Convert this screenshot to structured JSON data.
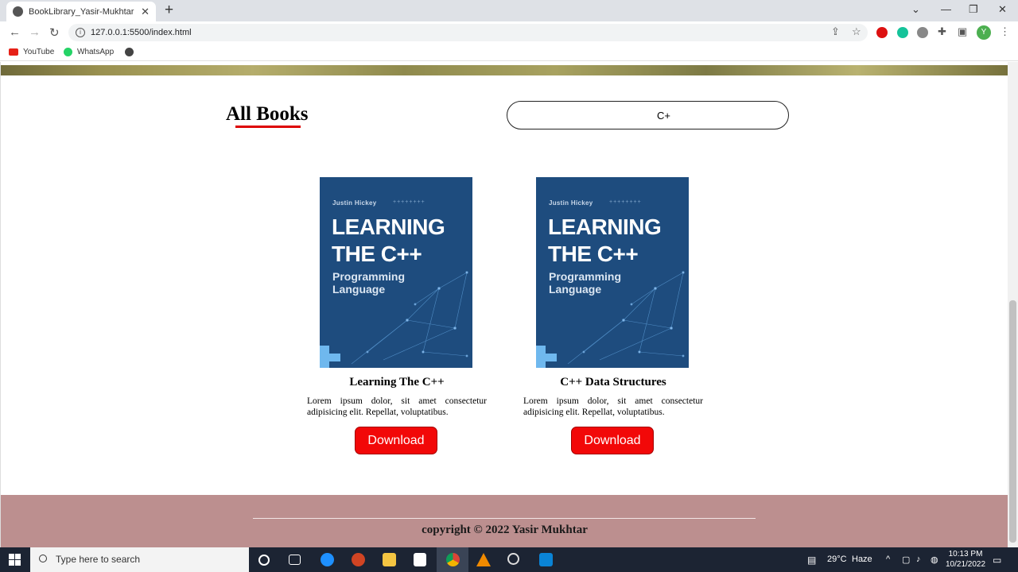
{
  "browser": {
    "tab_title": "BookLibrary_Yasir-Mukhtar",
    "url": "127.0.0.1:5500/index.html",
    "bookmarks": [
      {
        "label": "YouTube",
        "color": "#e62117"
      },
      {
        "label": "WhatsApp",
        "color": "#25d366"
      }
    ],
    "profile_initial": "Y"
  },
  "page": {
    "section_title": "All Books",
    "search_value": "C+",
    "books": [
      {
        "cover_author": "Justin Hickey",
        "cover_title_line1": "LEARNING",
        "cover_title_line2": "THE C++",
        "cover_sub_line1": "Programming",
        "cover_sub_line2": "Language",
        "name": "Learning The C++",
        "description": "Lorem ipsum dolor, sit amet consectetur adipisicing elit. Repellat, voluptatibus.",
        "button_label": "Download"
      },
      {
        "cover_author": "Justin Hickey",
        "cover_title_line1": "LEARNING",
        "cover_title_line2": "THE C++",
        "cover_sub_line1": "Programming",
        "cover_sub_line2": "Language",
        "name": "C++ Data Structures",
        "description": "Lorem ipsum dolor, sit amet consectetur adipisicing elit. Repellat, voluptatibus.",
        "button_label": "Download"
      }
    ],
    "footer_text": "copyright © 2022 Yasir Mukhtar"
  },
  "taskbar": {
    "search_placeholder": "Type here to search",
    "weather_temp": "29°C",
    "weather_cond": "Haze",
    "time": "10:13 PM",
    "date": "10/21/2022"
  },
  "colors": {
    "accent_red": "#f20808",
    "footer_bg": "#bc8f8f",
    "cover_blue": "#1e4c7e"
  }
}
